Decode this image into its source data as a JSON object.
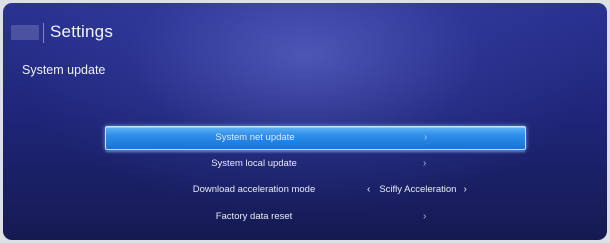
{
  "header": {
    "title": "Settings",
    "subtitle": "System update"
  },
  "menu": {
    "items": [
      {
        "label": "System net update",
        "chevron": "›",
        "selected": true
      },
      {
        "label": "System local update",
        "chevron": "›",
        "selected": false
      },
      {
        "label": "Download acceleration mode",
        "value": "Scifly Acceleration",
        "chevron_left": "‹",
        "chevron_right": "›",
        "selected": false
      },
      {
        "label": "Factory data reset",
        "chevron": "›",
        "selected": false
      }
    ]
  },
  "colors": {
    "background": "#1f267a",
    "highlight": "#2c8ce8",
    "text": "#ffffff"
  }
}
